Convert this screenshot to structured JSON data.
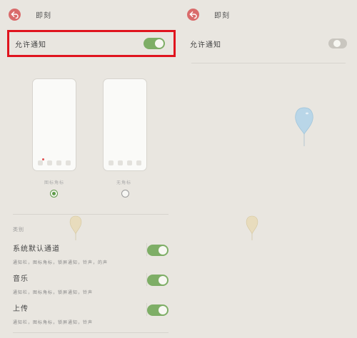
{
  "left": {
    "header": {
      "title": "即刻"
    },
    "notify_row": {
      "label": "允许通知",
      "enabled": true
    },
    "styles": [
      {
        "caption": "图标角标",
        "selected": true
      },
      {
        "caption": "无角标",
        "selected": false
      }
    ],
    "section_label": "类别",
    "categories": [
      {
        "title": "系统默认通道",
        "subtitle": "通知栏，图标角标，锁屏通知，铃声，的声",
        "enabled": true
      },
      {
        "title": "音乐",
        "subtitle": "通知栏，图标角标，锁屏通知，铃声",
        "enabled": true
      },
      {
        "title": "上传",
        "subtitle": "通知栏，图标角标，锁屏通知，铃声",
        "enabled": true
      }
    ]
  },
  "right": {
    "header": {
      "title": "即刻"
    },
    "notify_row": {
      "label": "允许通知",
      "enabled": false
    }
  },
  "colors": {
    "toggle_on": "#7eae66",
    "toggle_off": "#c9c6bf",
    "highlight": "#e0141e",
    "back_button": "#d96b6b",
    "radio_selected": "#5f9b4a"
  }
}
